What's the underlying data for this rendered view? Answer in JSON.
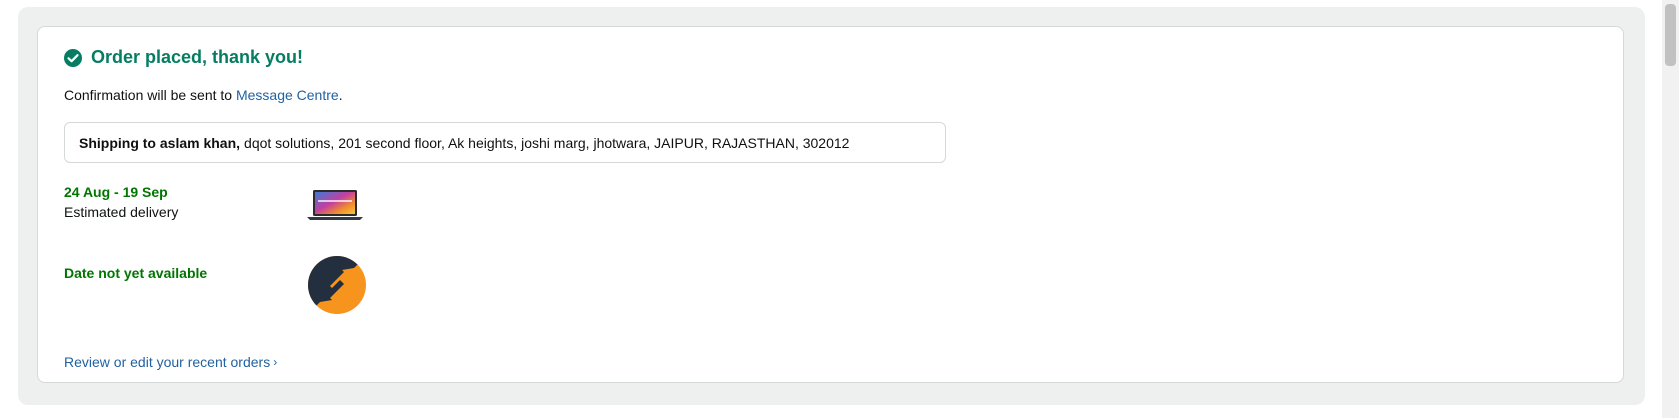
{
  "header": {
    "title": "Order placed, thank you!",
    "icon": "check-circle-icon"
  },
  "confirmation": {
    "prefix": "Confirmation will be sent to ",
    "link_label": "Message Centre",
    "suffix": "."
  },
  "shipping": {
    "name_label": "Shipping to aslam khan,",
    "address": "dqot solutions, 201 second floor, Ak heights, joshi marg, jhotwara, JAIPUR, RAJASTHAN, 302012"
  },
  "items": [
    {
      "date": "24 Aug - 19 Sep",
      "label": "Estimated delivery",
      "image": "laptop-product-icon"
    },
    {
      "date": "Date not yet available",
      "image": "exchange-arrows-icon"
    }
  ],
  "footer": {
    "review_link": "Review or edit your recent orders"
  },
  "colors": {
    "success": "#067d62",
    "delivery": "#007600",
    "link": "#2162a1",
    "border": "#d5d9d9",
    "outer_bg": "#eef0f0"
  }
}
